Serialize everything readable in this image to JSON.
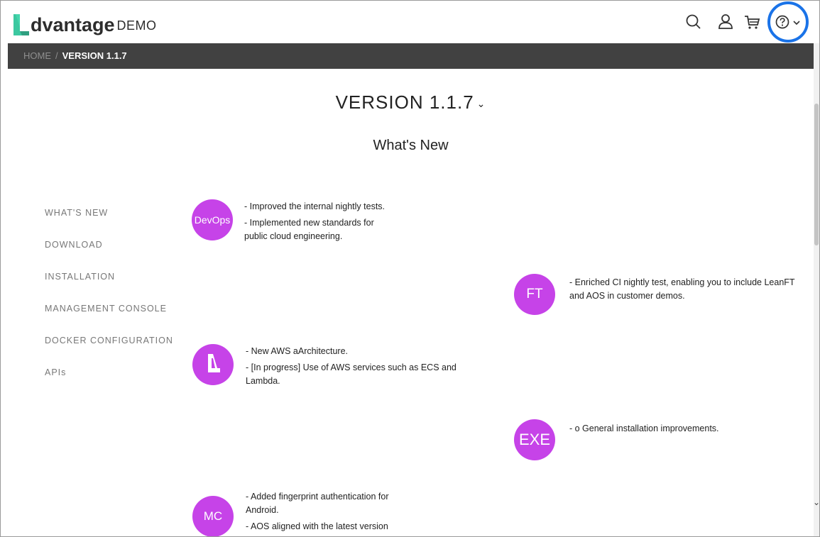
{
  "header": {
    "logo_word": "dvantage",
    "logo_suffix": "DEMO"
  },
  "breadcrumb": {
    "home": "HOME",
    "separator": "/",
    "current": "VERSION 1.1.7"
  },
  "page": {
    "title": "VERSION 1.1.7",
    "title_chevron": "⌄",
    "subtitle": "What's New"
  },
  "sidenav": {
    "items": [
      {
        "label": "WHAT'S NEW"
      },
      {
        "label": "DOWNLOAD"
      },
      {
        "label": "INSTALLATION"
      },
      {
        "label": "MANAGEMENT CONSOLE"
      },
      {
        "label": "DOCKER CONFIGURATION"
      },
      {
        "label": "APIs"
      }
    ]
  },
  "entries": [
    {
      "badge": "DevOps",
      "lines": [
        "- Improved the internal nightly tests.",
        "- Implemented new standards for",
        "public cloud engineering."
      ]
    },
    {
      "badge": "FT",
      "lines": [
        "- Enriched CI nightly test, enabling you to include LeanFT",
        "and AOS in customer demos."
      ]
    },
    {
      "badge": "",
      "icon": "advantage-logo-icon",
      "lines": [
        "- New AWS aArchitecture.",
        "- [In progress] Use of AWS services such as ECS and",
        "Lambda."
      ]
    },
    {
      "badge": "EXE",
      "lines": [
        "- o General installation improvements."
      ]
    },
    {
      "badge": "MC",
      "lines": [
        "- Added fingerprint authentication for",
        "Android.",
        "- AOS aligned with the latest version"
      ]
    }
  ],
  "colors": {
    "accent_purple": "#c643e8",
    "logo_green": "#3cc8a0",
    "crumb_bar": "#414141",
    "highlight_ring": "#1a73e8"
  },
  "icons": [
    "search-icon",
    "user-icon",
    "cart-icon",
    "help-icon",
    "chevron-down-icon"
  ]
}
